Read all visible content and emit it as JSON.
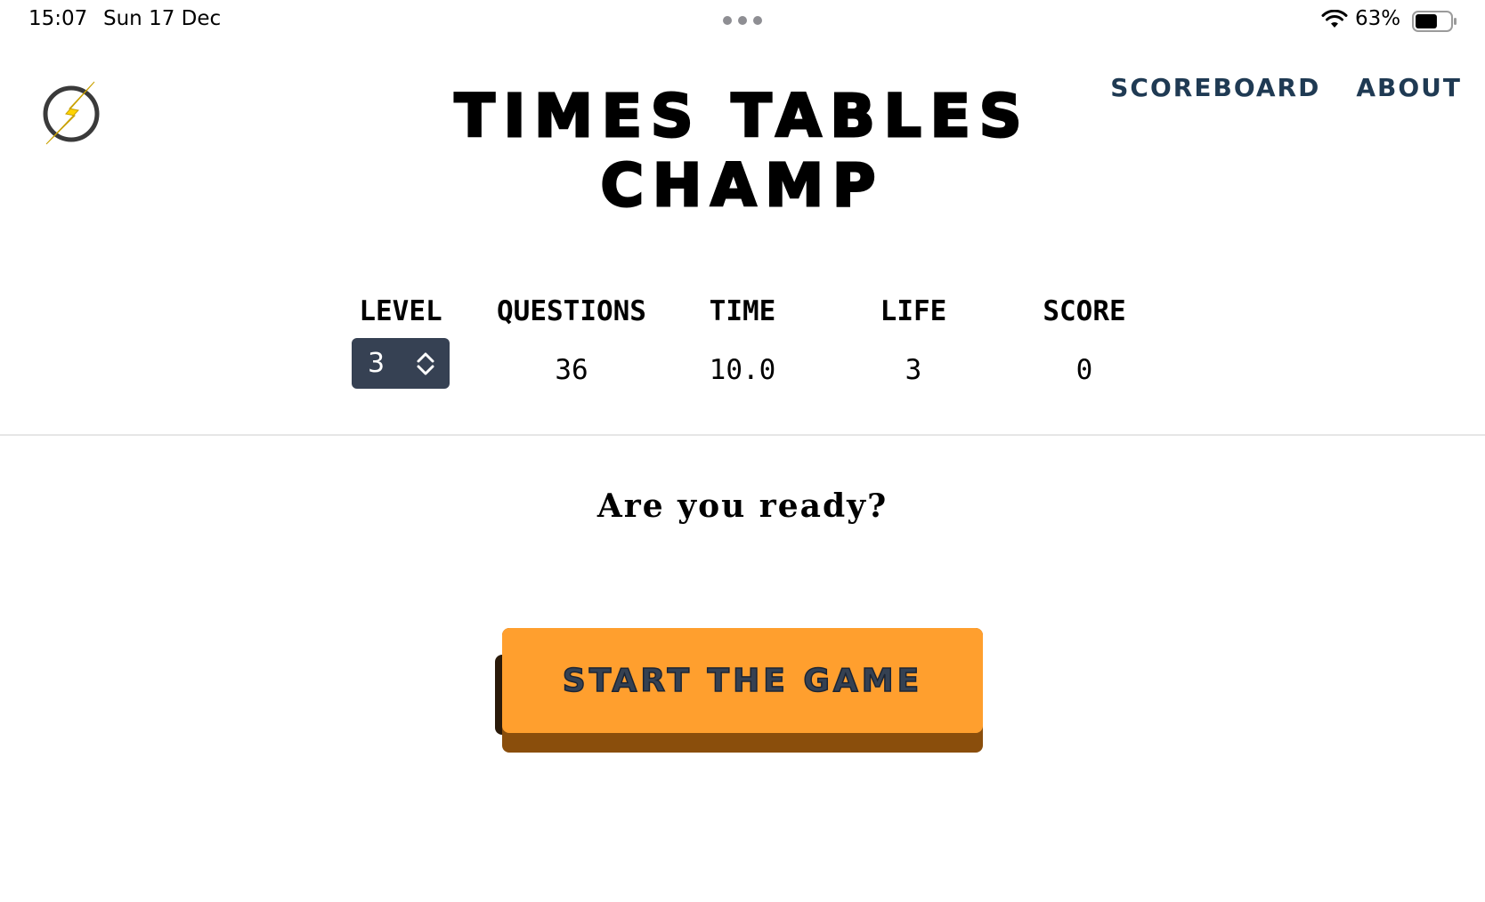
{
  "status_bar": {
    "time": "15:07",
    "date": "Sun 17 Dec",
    "battery_percent": "63%",
    "battery_level": 0.63,
    "wifi_icon": "wifi-icon",
    "battery_icon": "battery-icon"
  },
  "header": {
    "logo_icon": "lightning-bolt-icon",
    "title": "TIMES TABLES CHAMP",
    "nav": {
      "scoreboard": "SCOREBOARD",
      "about": "ABOUT"
    }
  },
  "stats": {
    "level": {
      "label": "LEVEL",
      "value": "3"
    },
    "questions": {
      "label": "QUESTIONS",
      "value": "36"
    },
    "time": {
      "label": "TIME",
      "value": "10.0"
    },
    "life": {
      "label": "LIFE",
      "value": "3"
    },
    "score": {
      "label": "SCORE",
      "value": "0"
    }
  },
  "game": {
    "prompt": "Are you ready?",
    "start_label": "START THE GAME"
  },
  "colors": {
    "accent_orange": "#ff9f2e",
    "select_bg": "#364153",
    "nav_text": "#1f3a53",
    "lightning_yellow": "#ffd400"
  }
}
